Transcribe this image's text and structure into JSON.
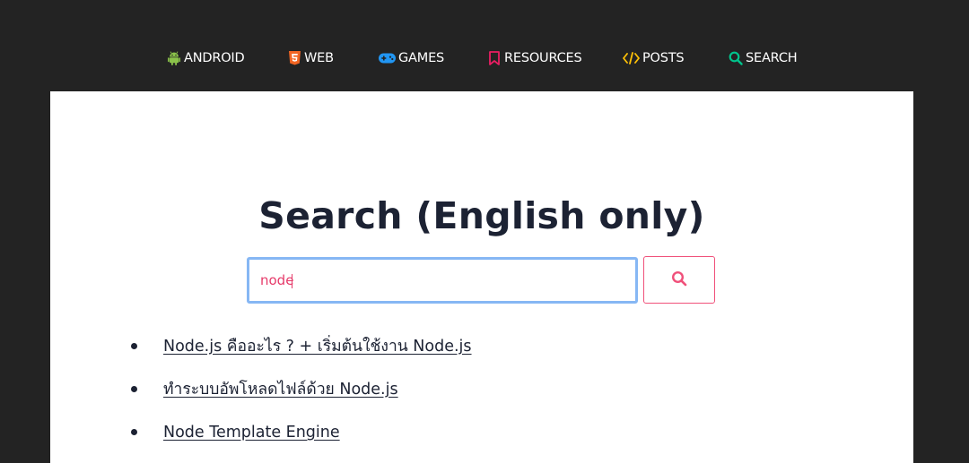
{
  "nav": {
    "items": [
      {
        "label": "ANDROID",
        "icon": "android-icon",
        "color": "#8bc34a"
      },
      {
        "label": "WEB",
        "icon": "html5-icon",
        "color": "#f26522"
      },
      {
        "label": "GAMES",
        "icon": "gamepad-icon",
        "color": "#2196f3"
      },
      {
        "label": "RESOURCES",
        "icon": "bookmark-icon",
        "color": "#e91e63"
      },
      {
        "label": "POSTS",
        "icon": "code-icon",
        "color": "#ffc107"
      },
      {
        "label": "SEARCH",
        "icon": "search-icon",
        "color": "#00c48c"
      }
    ]
  },
  "main": {
    "title": "Search (English only)",
    "search": {
      "value": "node",
      "placeholder": "",
      "input_border_color": "#86b7f4",
      "button_icon": "search-icon",
      "button_color": "#f0507a"
    },
    "results": [
      {
        "label": "Node.js คืออะไร ? + เริ่มต้นใช้งาน Node.js"
      },
      {
        "label": "ทำระบบอัพโหลดไฟล์ด้วย Node.js"
      },
      {
        "label": "Node Template Engine"
      }
    ]
  },
  "colors": {
    "background": "#232323",
    "card": "#ffffff",
    "text": "#1c2233",
    "input_text": "#e63b6a"
  }
}
